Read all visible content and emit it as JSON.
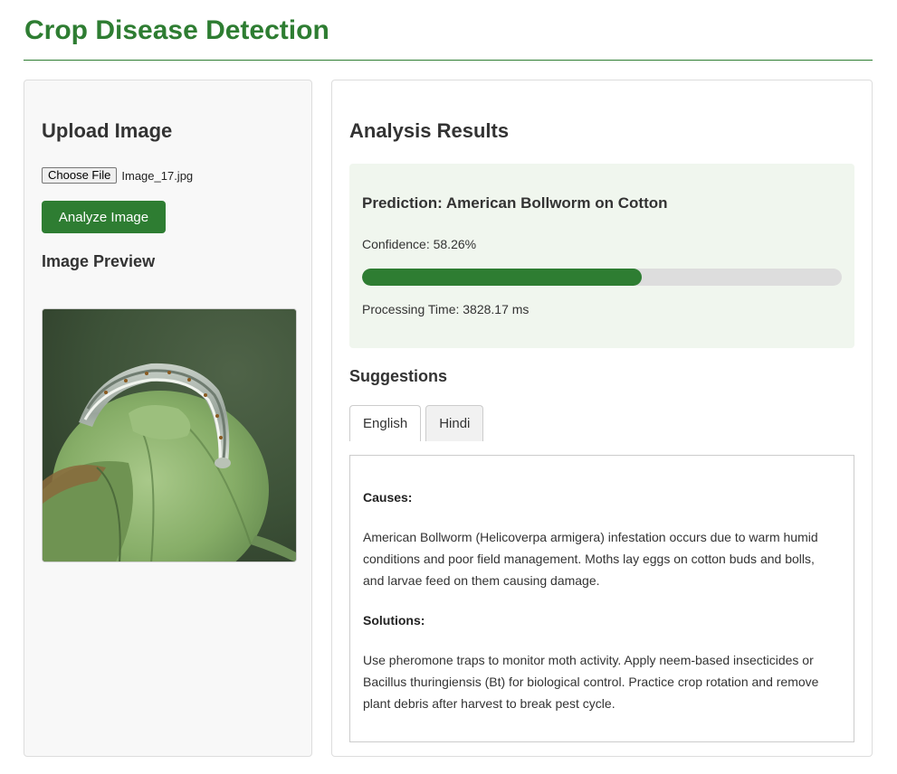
{
  "header": {
    "title": "Crop Disease Detection"
  },
  "upload_panel": {
    "heading": "Upload Image",
    "choose_file_label": "Choose File",
    "file_name": "Image_17.jpg",
    "analyze_label": "Analyze Image",
    "preview_heading": "Image Preview",
    "preview_alt": "Caterpillar on cotton boll"
  },
  "results_panel": {
    "heading": "Analysis Results",
    "prediction": "Prediction: American Bollworm on Cotton",
    "confidence_text": "Confidence: 58.26%",
    "confidence_value": 0.5826,
    "processing_time_text": "Processing Time: 3828.17 ms",
    "suggestions_heading": "Suggestions",
    "tabs": [
      {
        "label": "English",
        "active": true
      },
      {
        "label": "Hindi",
        "active": false
      }
    ],
    "content": {
      "causes_label": "Causes:",
      "causes_text": "American Bollworm (Helicoverpa armigera) infestation occurs due to warm humid conditions and poor field management. Moths lay eggs on cotton buds and bolls, and larvae feed on them causing damage.",
      "solutions_label": "Solutions:",
      "solutions_text": "Use pheromone traps to monitor moth activity. Apply neem-based insecticides or Bacillus thuringiensis (Bt) for biological control. Practice crop rotation and remove plant debris after harvest to break pest cycle."
    }
  },
  "colors": {
    "brand_green": "#2e7d32",
    "result_bg": "#f0f6ee",
    "progress_track": "#dddddd"
  }
}
